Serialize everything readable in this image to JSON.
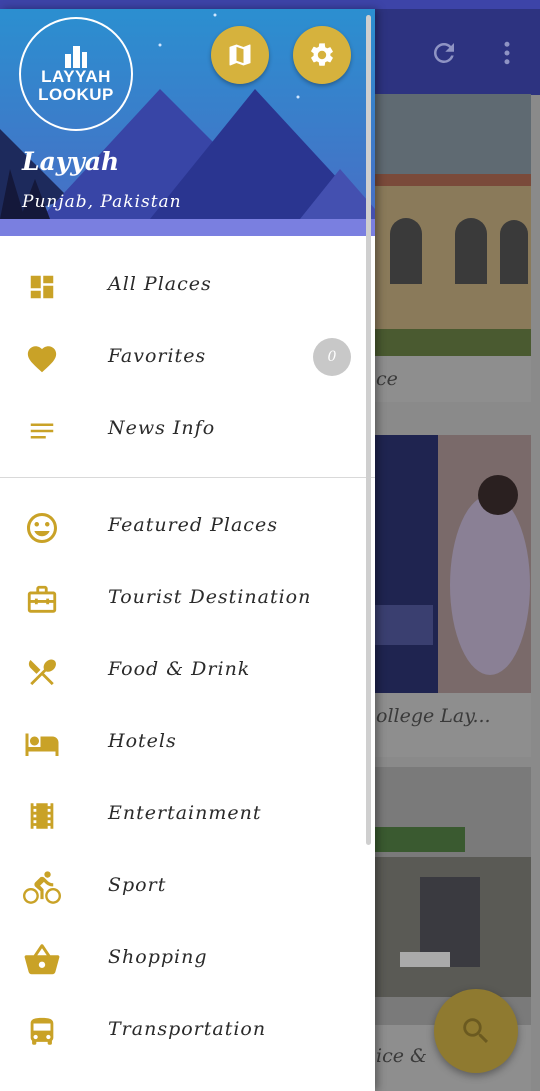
{
  "colors": {
    "accent": "#d6b23d",
    "primary": "#3d44a8",
    "icon": "#c9a227"
  },
  "header": {
    "logo_line1": "LAYYAH",
    "logo_line2": "LOOKUP",
    "title": "Layyah",
    "subtitle": "Punjab, Pakistan",
    "map_icon": "map-icon",
    "settings_icon": "gear-icon"
  },
  "menu": {
    "all_places": "All Places",
    "favorites": "Favorites",
    "favorites_count": "0",
    "news_info": "News Info",
    "featured_places": "Featured Places",
    "tourist_destination": "Tourist Destination",
    "food_drink": "Food & Drink",
    "hotels": "Hotels",
    "entertainment": "Entertainment",
    "sport": "Sport",
    "shopping": "Shopping",
    "transportation": "Transportation"
  },
  "background": {
    "card1_caption": "ce",
    "card2_caption": "ollege Lay...",
    "card3_caption": "ice &",
    "refresh_icon": "refresh-icon",
    "more_icon": "more-vert-icon",
    "search_icon": "search-icon"
  }
}
